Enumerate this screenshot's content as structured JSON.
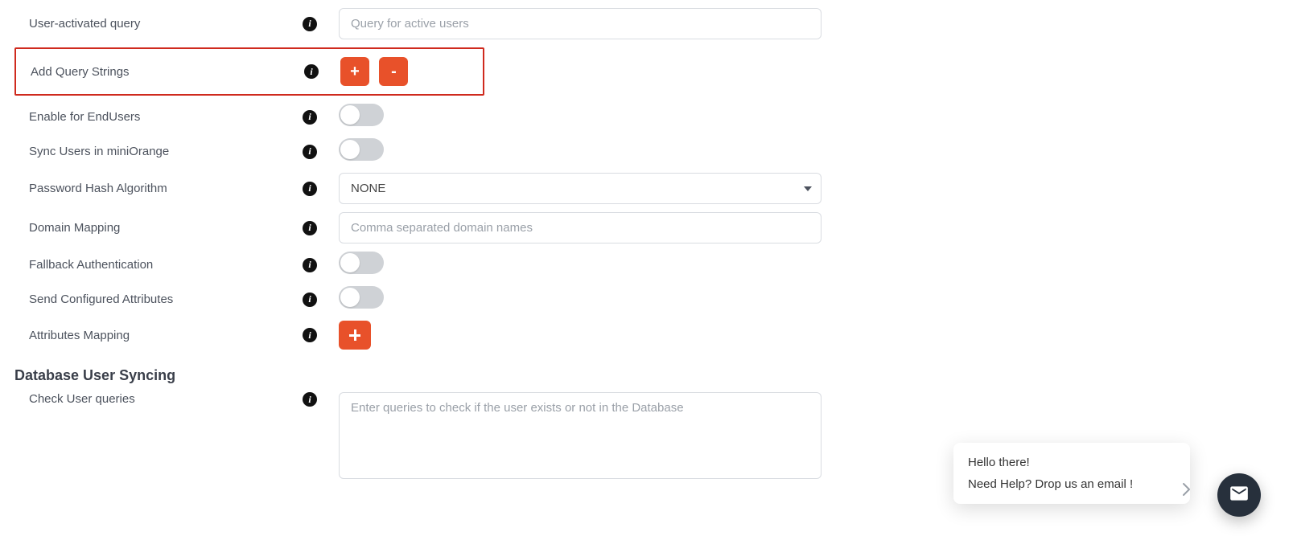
{
  "form": {
    "user_activated_query": {
      "label": "User-activated query",
      "placeholder": "Query for active users",
      "value": ""
    },
    "add_query_strings": {
      "label": "Add Query Strings",
      "plus_label": "+",
      "minus_label": "-"
    },
    "enable_endusers": {
      "label": "Enable for EndUsers",
      "on": false
    },
    "sync_users": {
      "label": "Sync Users in miniOrange",
      "on": false
    },
    "password_hash": {
      "label": "Password Hash Algorithm",
      "selected": "NONE",
      "options": [
        "NONE"
      ]
    },
    "domain_mapping": {
      "label": "Domain Mapping",
      "placeholder": "Comma separated domain names",
      "value": ""
    },
    "fallback_auth": {
      "label": "Fallback Authentication",
      "on": false
    },
    "send_attrs": {
      "label": "Send Configured Attributes",
      "on": false
    },
    "attrs_mapping": {
      "label": "Attributes Mapping"
    }
  },
  "section": {
    "db_user_syncing": "Database User Syncing"
  },
  "sync": {
    "check_user_queries": {
      "label": "Check User queries",
      "placeholder": "Enter queries to check if the user exists or not in the Database",
      "value": ""
    }
  },
  "chat": {
    "greeting": "Hello there!",
    "prompt": "Need Help? Drop us an email !"
  },
  "colors": {
    "accent": "#e8512a",
    "highlight_border": "#cf2a1e"
  }
}
